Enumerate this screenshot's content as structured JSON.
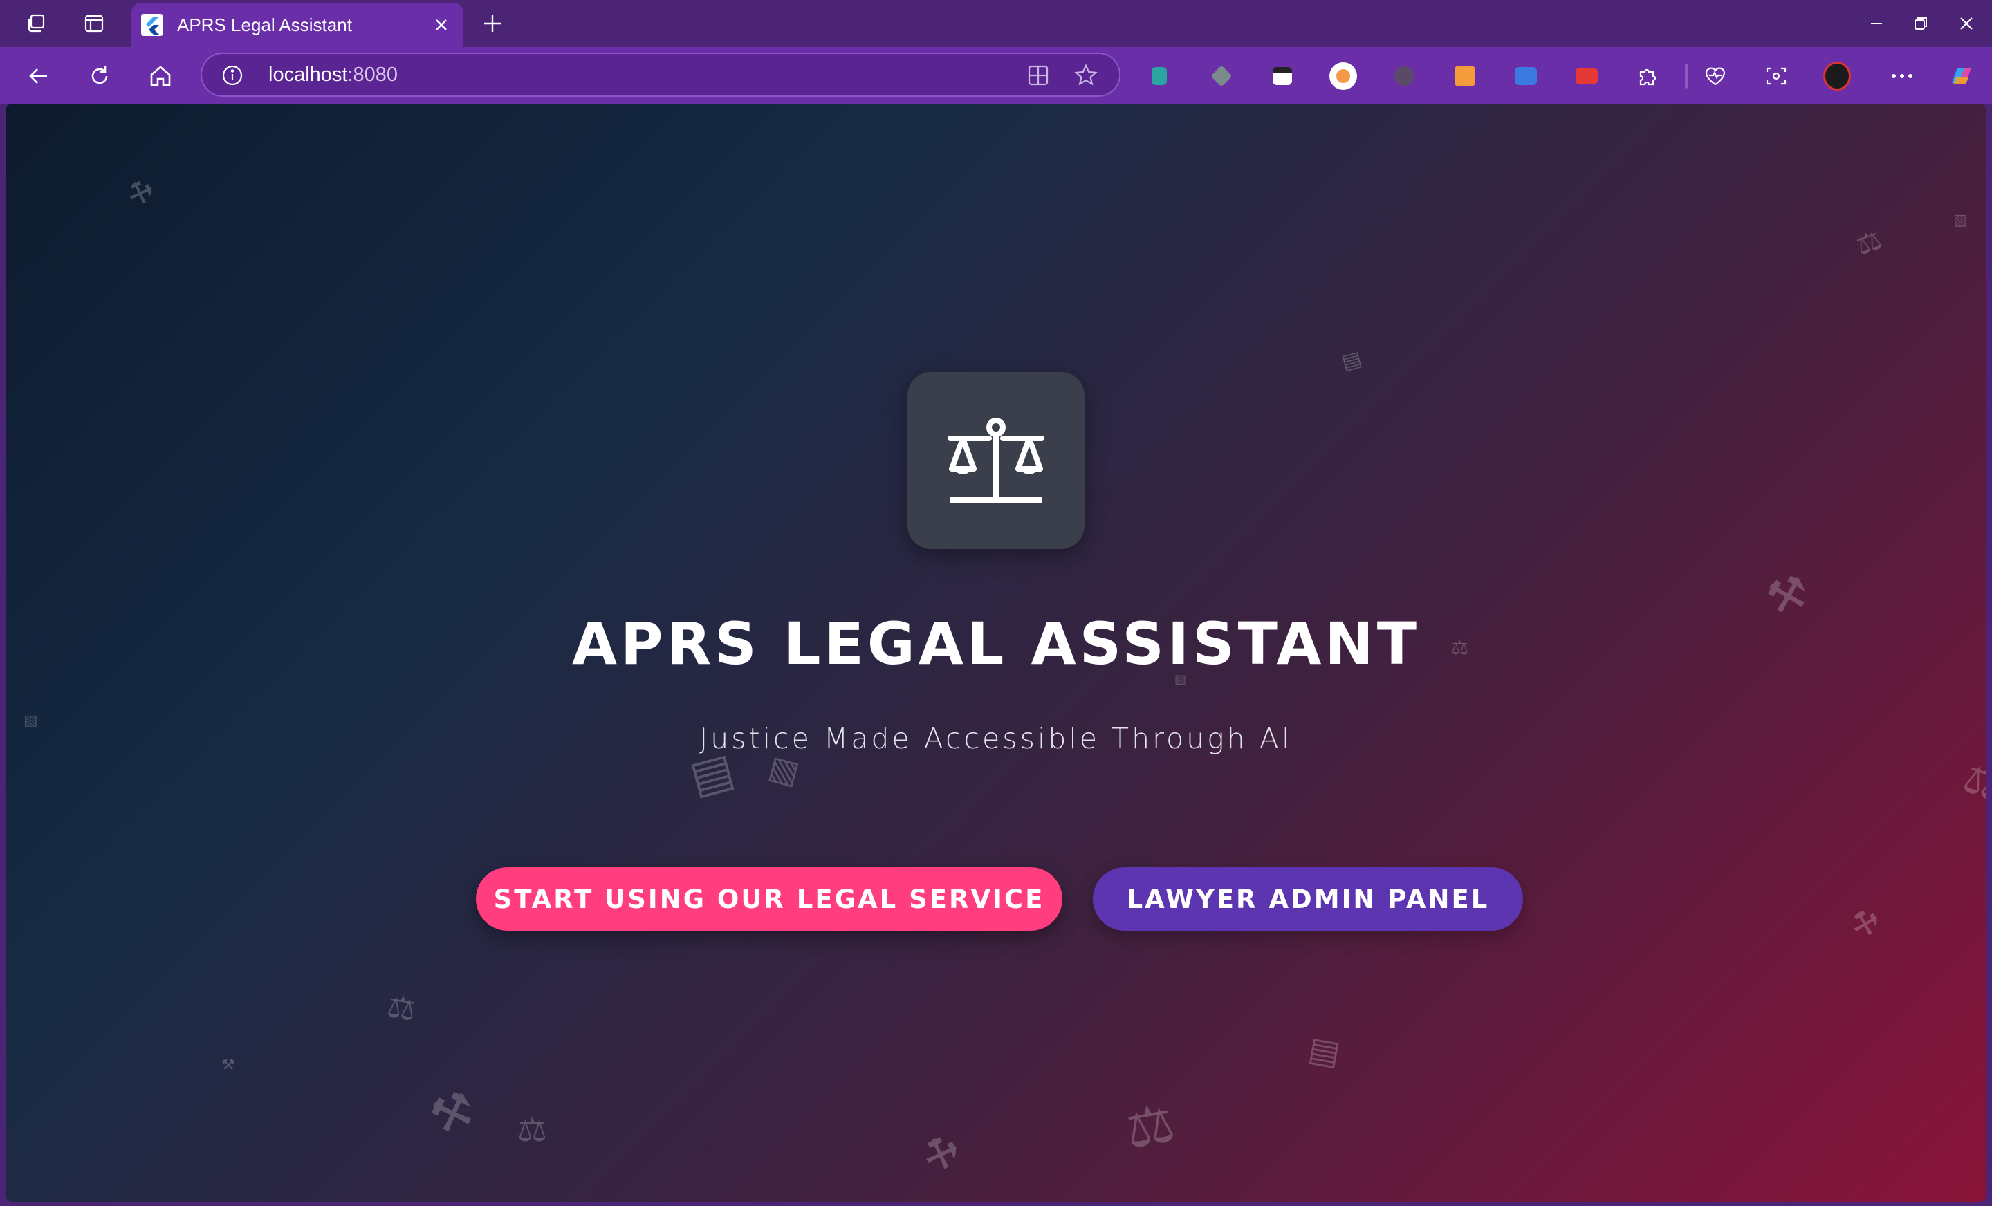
{
  "browser": {
    "tab_title": "APRS Legal Assistant",
    "url_host": "localhost",
    "url_port": ":8080",
    "icons": {
      "workspaces": "workspaces-icon",
      "tab_actions": "tab-actions-icon",
      "new_tab": "plus-icon",
      "back": "back-arrow-icon",
      "refresh": "refresh-icon",
      "home": "home-icon",
      "site_info": "info-icon",
      "split_screen": "split-screen-icon",
      "favorite": "star-icon",
      "extensions": "puzzle-icon",
      "health": "heartbeat-icon",
      "screenshot": "screenshot-icon",
      "more": "more-dots-icon",
      "copilot": "copilot-icon"
    },
    "colors": {
      "titlebar": "#4b2475",
      "toolbar": "#6a2fa8"
    }
  },
  "hero": {
    "title": "APRS LEGAL ASSISTANT",
    "subtitle": "Justice Made Accessible Through AI",
    "logo_icon": "scales-of-justice-icon",
    "primary_button": "START USING OUR LEGAL SERVICE",
    "secondary_button": "LAWYER ADMIN PANEL",
    "colors": {
      "primary_button": "#ff3d7f",
      "secondary_button": "#5e35b1",
      "gradient_start": "#0d1a2d",
      "gradient_end": "#8a1339"
    }
  }
}
